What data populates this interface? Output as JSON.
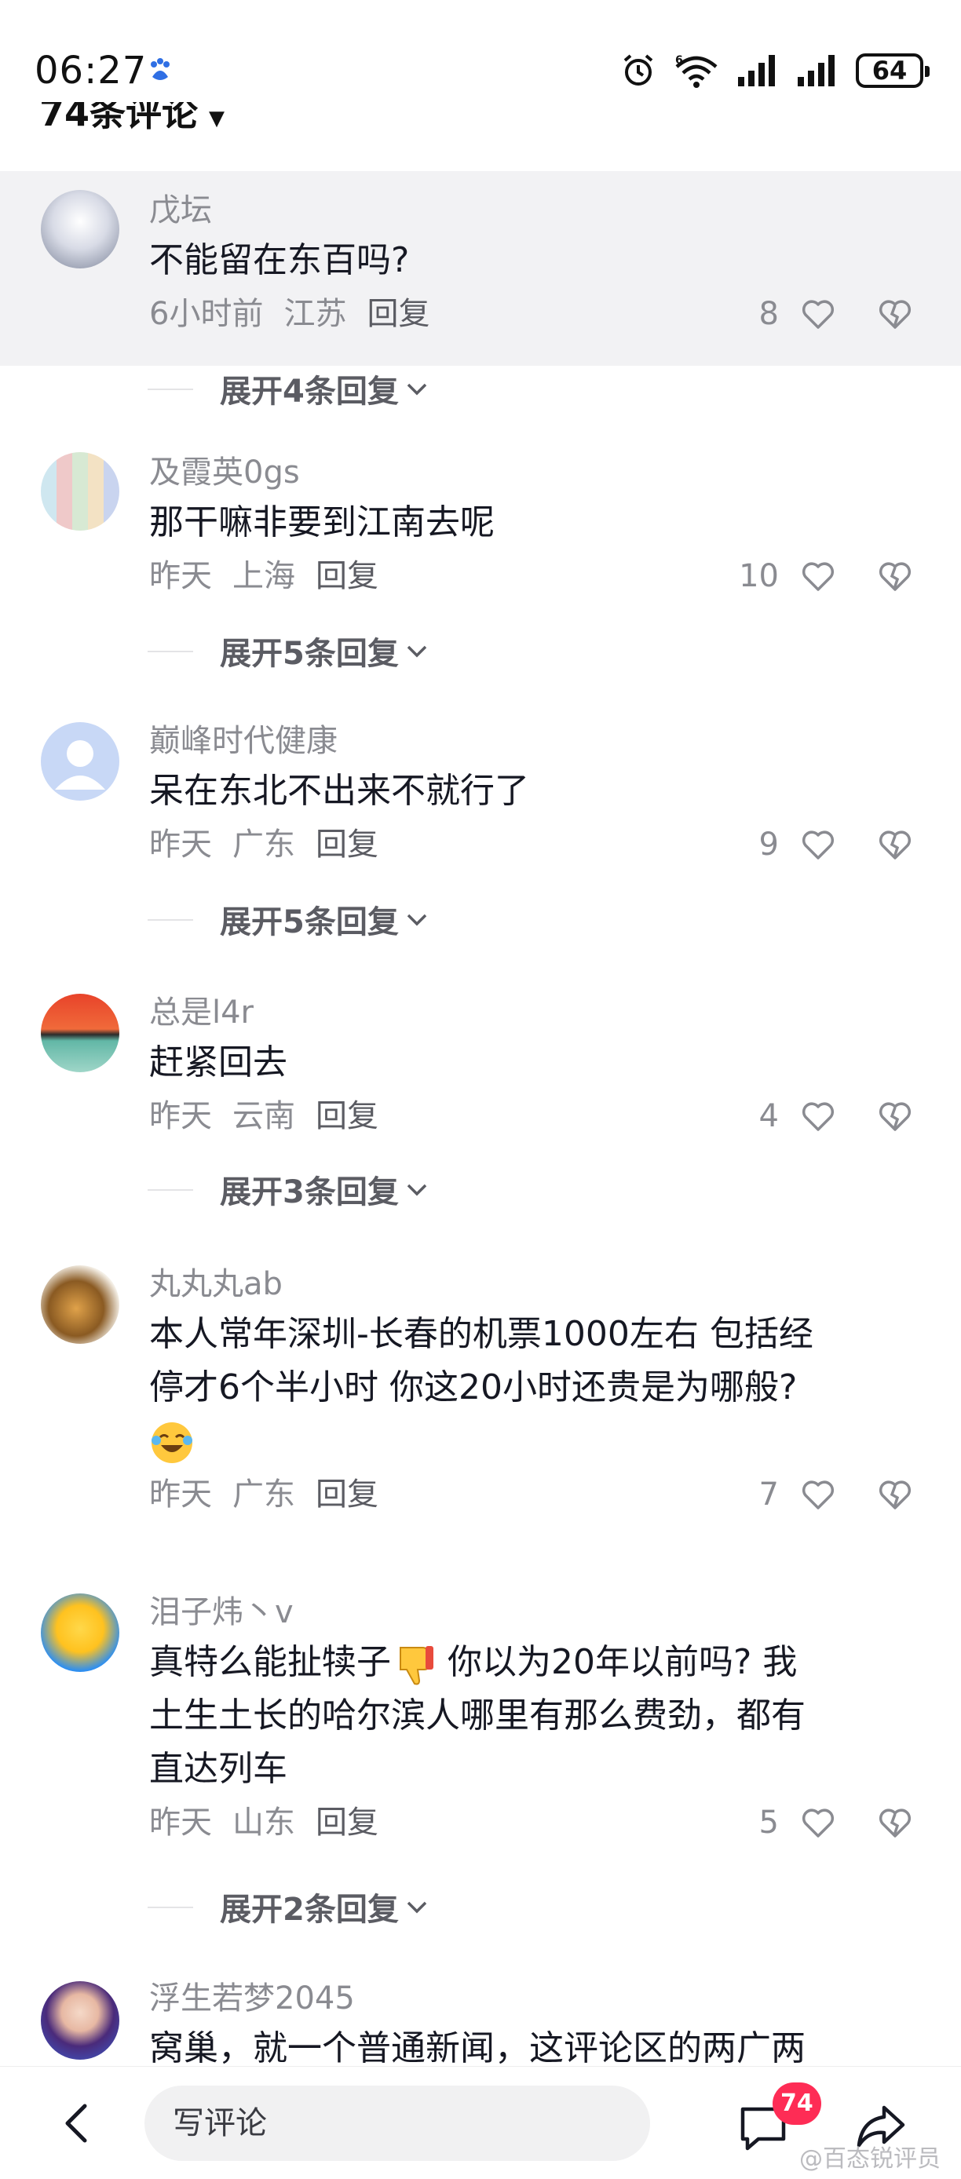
{
  "status_bar": {
    "time": "06:27",
    "network": "6",
    "battery": "64"
  },
  "header": {
    "comment_count_title": "74条评论",
    "caret": "▼"
  },
  "comments": [
    {
      "username": "戊坛",
      "text": "不能留在东百吗?",
      "time": "6小时前",
      "location": "江苏",
      "reply": "回复",
      "likes": "8",
      "expand": "展开4条回复",
      "highlighted": true
    },
    {
      "username": "及霞英0gs",
      "text": "那干嘛非要到江南去呢",
      "time": "昨天",
      "location": "上海",
      "reply": "回复",
      "likes": "10",
      "expand": "展开5条回复"
    },
    {
      "username": "巅峰时代健康",
      "text": "呆在东北不出来不就行了",
      "time": "昨天",
      "location": "广东",
      "reply": "回复",
      "likes": "9",
      "expand": "展开5条回复"
    },
    {
      "username": "总是l4r",
      "text": "赶紧回去",
      "time": "昨天",
      "location": "云南",
      "reply": "回复",
      "likes": "4",
      "expand": "展开3条回复"
    },
    {
      "username": "丸丸丸ab",
      "text_lines": [
        "本人常年深圳-长春的机票1000左右 包括经",
        "停才6个半小时 你这20小时还贵是为哪般?"
      ],
      "emoji": "laughing-crying-emoji",
      "time": "昨天",
      "location": "广东",
      "reply": "回复",
      "likes": "7"
    },
    {
      "username": "泪子炜丶v",
      "text_part1": "真特么能扯犊子",
      "emoji": "thumbs-down-emoji",
      "text_part2": " 你以为20年以前吗? 我",
      "text_lines": [
        "土生土长的哈尔滨人哪里有那么费劲，都有",
        "直达列车"
      ],
      "time": "昨天",
      "location": "山东",
      "reply": "回复",
      "likes": "5",
      "expand": "展开2条回复"
    },
    {
      "username": "浮生若梦2045",
      "text": "窝巢，就一个普通新闻，这评论区的两广两"
    }
  ],
  "bottom_bar": {
    "write_placeholder": "写评论",
    "comment_badge": "74",
    "watermark": "@百态锐评员"
  },
  "colors": {
    "accent": "#fe2c55",
    "highlight_bg": "#f2f2f4",
    "secondary_text": "#8a8b91"
  }
}
